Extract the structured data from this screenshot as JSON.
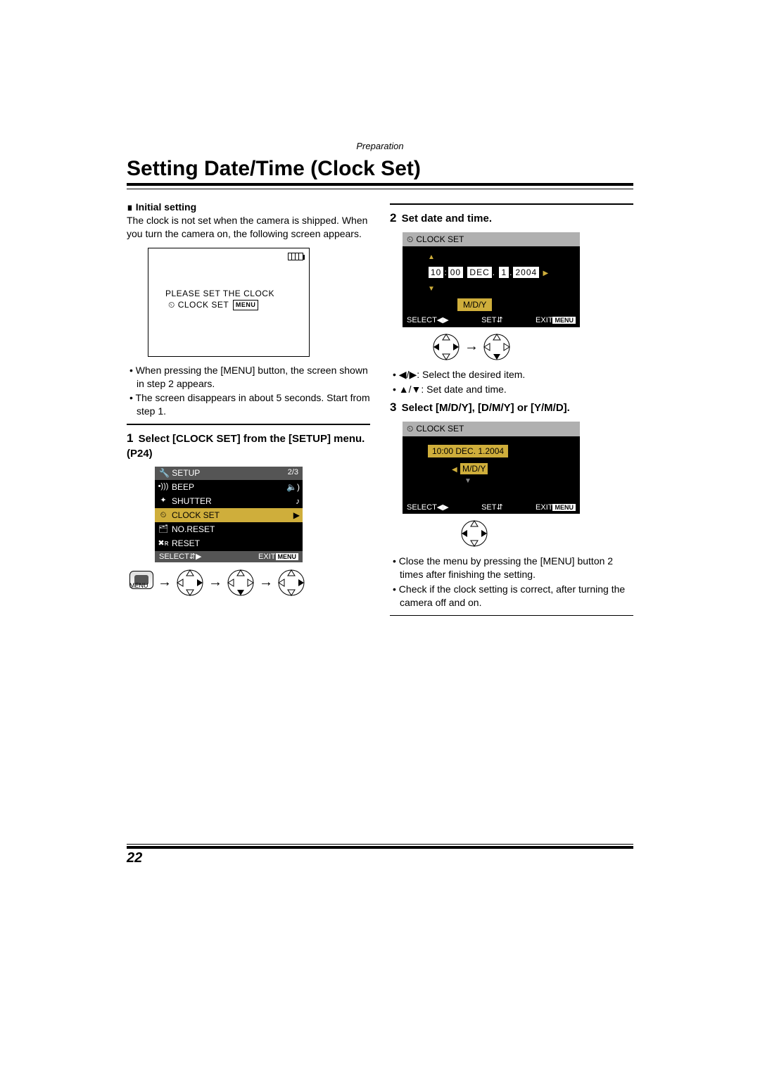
{
  "section_label": "Preparation",
  "title": "Setting Date/Time (Clock Set)",
  "left": {
    "initial_heading": "Initial setting",
    "initial_para": "The clock is not set when the camera is shipped. When you turn the camera on, the following screen appears.",
    "lcd_msg_line1": "PLEASE SET THE CLOCK",
    "lcd_msg_line2_prefix": "CLOCK SET",
    "menu_badge": "MENU",
    "bullets1": [
      "When pressing the [MENU] button, the screen shown in step 2 appears.",
      "The screen disappears in about 5 seconds. Start from step 1."
    ],
    "step1_num": "1",
    "step1_title": "Select [CLOCK SET] from the [SETUP] menu. (P24)",
    "setup_head_label": "SETUP",
    "setup_head_page": "2/3",
    "setup_items": [
      "BEEP",
      "SHUTTER",
      "CLOCK SET",
      "NO.RESET",
      "RESET"
    ],
    "setup_select": "SELECT",
    "setup_exit": "EXIT",
    "menu_btn_label": "MENU"
  },
  "right": {
    "step2_num": "2",
    "step2_title": "Set date and time.",
    "clock_title": "CLOCK SET",
    "date_parts": {
      "hh": "10",
      "sep": ":",
      "mm": "00",
      "mon": "DEC",
      "dsep": ".",
      "dd": "1",
      "ysep": ".",
      "yy": "2004"
    },
    "date_format": "M/D/Y",
    "ft_select": "SELECT",
    "ft_set": "SET",
    "ft_exit": "EXIT",
    "ft_menu": "MENU",
    "bullets2a": "◀/▶: Select the desired item.",
    "bullets2b": "▲/▼: Set date and time.",
    "step3_num": "3",
    "step3_title": "Select [M/D/Y], [D/M/Y] or [Y/M/D].",
    "date_plain": "10:00  DEC.  1.2004",
    "bullets3": [
      "Close the menu by pressing the [MENU] button 2 times after finishing the setting.",
      "Check if the clock setting is correct, after turning the camera off and on."
    ]
  },
  "page_number": "22"
}
